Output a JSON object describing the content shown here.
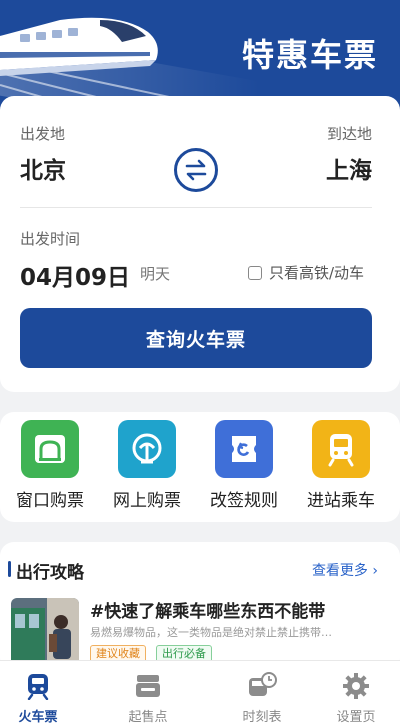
{
  "header": {
    "title": "特惠车票"
  },
  "search": {
    "from_label": "出发地",
    "to_label": "到达地",
    "from_city": "北京",
    "to_city": "上海",
    "date_label": "出发时间",
    "date_value": "04月09日",
    "date_hint": "明天",
    "high_speed_label": "只看高铁/动车",
    "query_button": "查询火车票"
  },
  "services": [
    {
      "label": "窗口购票",
      "icon": "ticket-window-icon",
      "color": "#3fb354"
    },
    {
      "label": "网上购票",
      "icon": "railway-logo-icon",
      "color": "#1fa3cc"
    },
    {
      "label": "改签规则",
      "icon": "exchange-ticket-icon",
      "color": "#3f6fd8"
    },
    {
      "label": "进站乘车",
      "icon": "train-front-icon",
      "color": "#f2b417"
    }
  ],
  "guide": {
    "title": "出行攻略",
    "more": "查看更多",
    "article": {
      "title": "#快速了解乘车哪些东西不能带",
      "desc": "易燃易爆物品，这一类物品是绝对禁止禁止携带…",
      "tags": [
        "建议收藏",
        "出行必备"
      ]
    }
  },
  "tabbar": [
    {
      "label": "火车票",
      "icon": "train-icon",
      "active": true
    },
    {
      "label": "起售点",
      "icon": "ticket-stack-icon",
      "active": false
    },
    {
      "label": "时刻表",
      "icon": "train-clock-icon",
      "active": false
    },
    {
      "label": "设置页",
      "icon": "gear-icon",
      "active": false
    }
  ],
  "colors": {
    "primary": "#1d4a9b",
    "background": "#f1f2f4",
    "link": "#2a63c9"
  }
}
